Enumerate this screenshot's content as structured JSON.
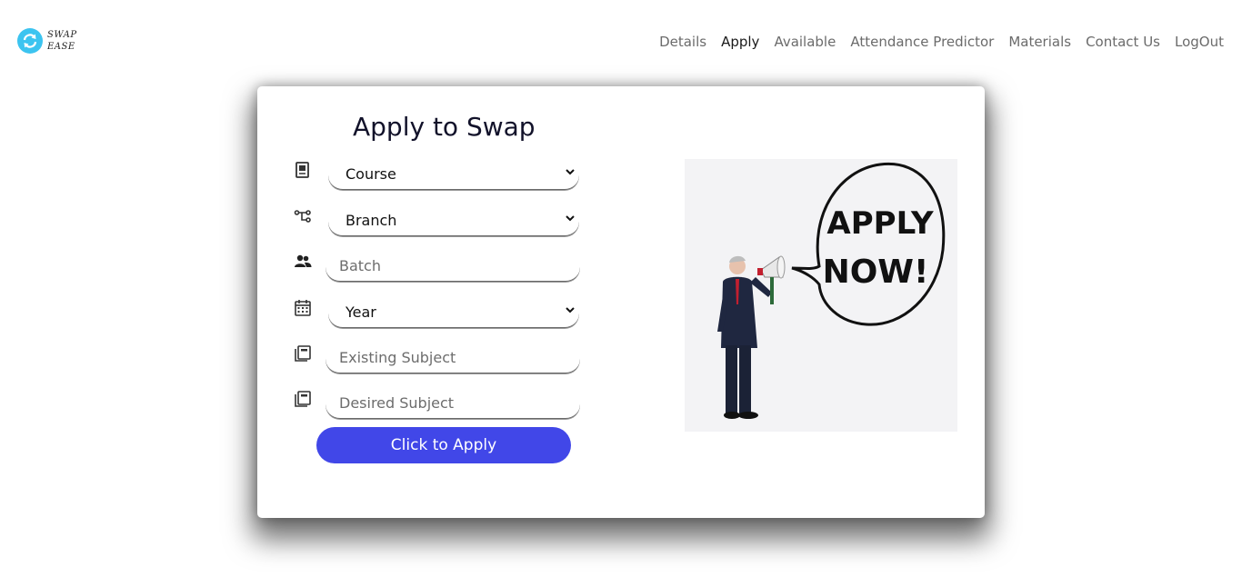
{
  "brand": {
    "line1": "SWAP",
    "line2": "EASE"
  },
  "nav": [
    {
      "label": "Details",
      "active": false
    },
    {
      "label": "Apply",
      "active": true
    },
    {
      "label": "Available",
      "active": false
    },
    {
      "label": "Attendance Predictor",
      "active": false
    },
    {
      "label": "Materials",
      "active": false
    },
    {
      "label": "Contact Us",
      "active": false
    },
    {
      "label": "LogOut",
      "active": false
    }
  ],
  "form": {
    "title": "Apply to Swap",
    "course": {
      "value": "Course",
      "icon": "book-icon"
    },
    "branch": {
      "value": "Branch",
      "icon": "branch-icon"
    },
    "batch": {
      "placeholder": "Batch",
      "icon": "users-icon"
    },
    "year": {
      "value": "Year",
      "icon": "calendar-icon"
    },
    "existing_subject": {
      "placeholder": "Existing Subject",
      "icon": "subject-book-icon"
    },
    "desired_subject": {
      "placeholder": "Desired Subject",
      "icon": "subject-book-icon"
    },
    "submit_label": "Click to Apply"
  },
  "illustration": {
    "bubble_line1": "APPLY",
    "bubble_line2": "NOW!"
  },
  "colors": {
    "accent": "#4147e8",
    "logo": "#3cc4f0",
    "nav_text": "#6b6b6b"
  }
}
